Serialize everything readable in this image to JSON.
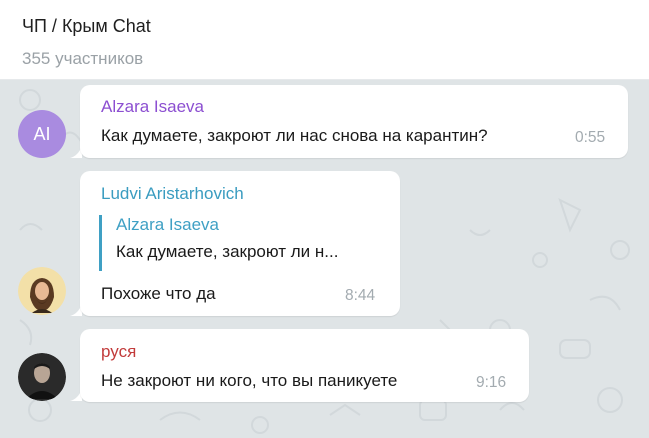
{
  "header": {
    "title": "ЧП / Крым Chat",
    "subtitle": "355 участников"
  },
  "colors": {
    "background": "#dfe4e6",
    "bubble": "#ffffff",
    "sender_alzara": "#8c4fd1",
    "sender_ludvi": "#3a9cc0",
    "sender_rusya": "#c23b3b",
    "time": "#a3abb0"
  },
  "messages": [
    {
      "sender": "Alzara Isaeva",
      "avatar_initials": "AI",
      "text": "Как думаете, закроют ли нас снова на карантин?",
      "time": "0:55"
    },
    {
      "sender": "Ludvi Aristarhovich",
      "avatar": "bearded-man-avatar",
      "reply": {
        "name": "Alzara Isaeva",
        "text": "Как думаете, закроют ли н..."
      },
      "text": "Похоже что да",
      "time": "8:44"
    },
    {
      "sender": "руся",
      "avatar": "man-photo-avatar",
      "text": "Не закроют ни кого, что вы паникуете",
      "time": "9:16"
    }
  ]
}
